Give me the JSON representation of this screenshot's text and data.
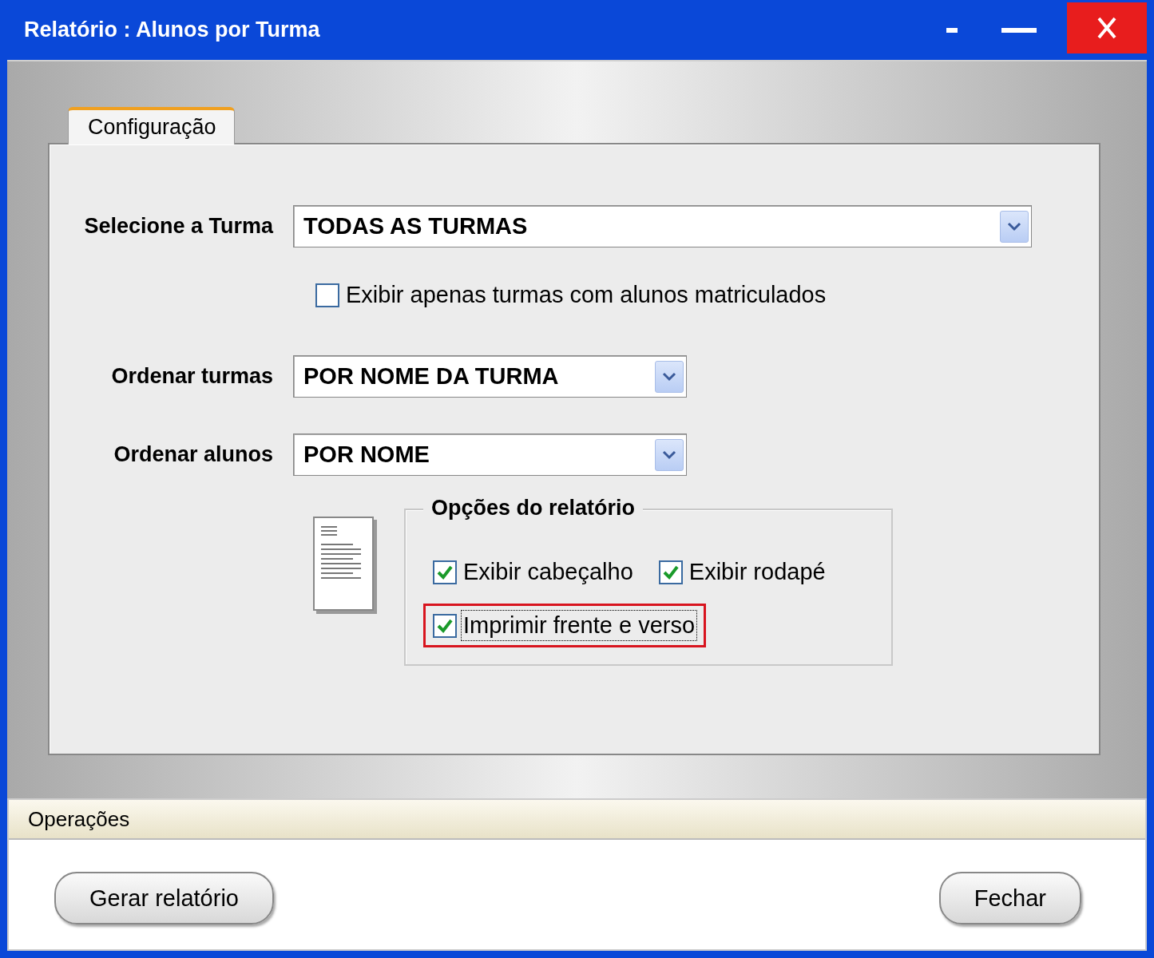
{
  "window": {
    "title": "Relatório : Alunos por Turma"
  },
  "tabs": [
    {
      "label": "Configuração",
      "selected": true
    }
  ],
  "form_rows": [
    {
      "kind": "select",
      "label": "Selecione a Turma",
      "value": "TODAS AS TURMAS"
    },
    {
      "kind": "checkbox",
      "label": "Exibir apenas turmas com alunos matriculados",
      "checked": false
    },
    {
      "kind": "select",
      "label": "Ordenar turmas",
      "value": "POR NOME DA TURMA"
    },
    {
      "kind": "select",
      "label": "Ordenar alunos",
      "value": "POR NOME"
    }
  ],
  "report_options": {
    "title": "Opções do relatório",
    "rows": [
      [
        {
          "label": "Exibir cabeçalho",
          "checked": true,
          "focused": false,
          "highlighted": false
        },
        {
          "label": "Exibir rodapé",
          "checked": true,
          "focused": false,
          "highlighted": false
        }
      ],
      [
        {
          "label": "Imprimir frente e verso",
          "checked": true,
          "focused": true,
          "highlighted": true
        }
      ]
    ]
  },
  "operations": {
    "title": "Operações",
    "buttons": [
      {
        "label": "Gerar relatório"
      },
      {
        "label": "Fechar"
      }
    ]
  }
}
